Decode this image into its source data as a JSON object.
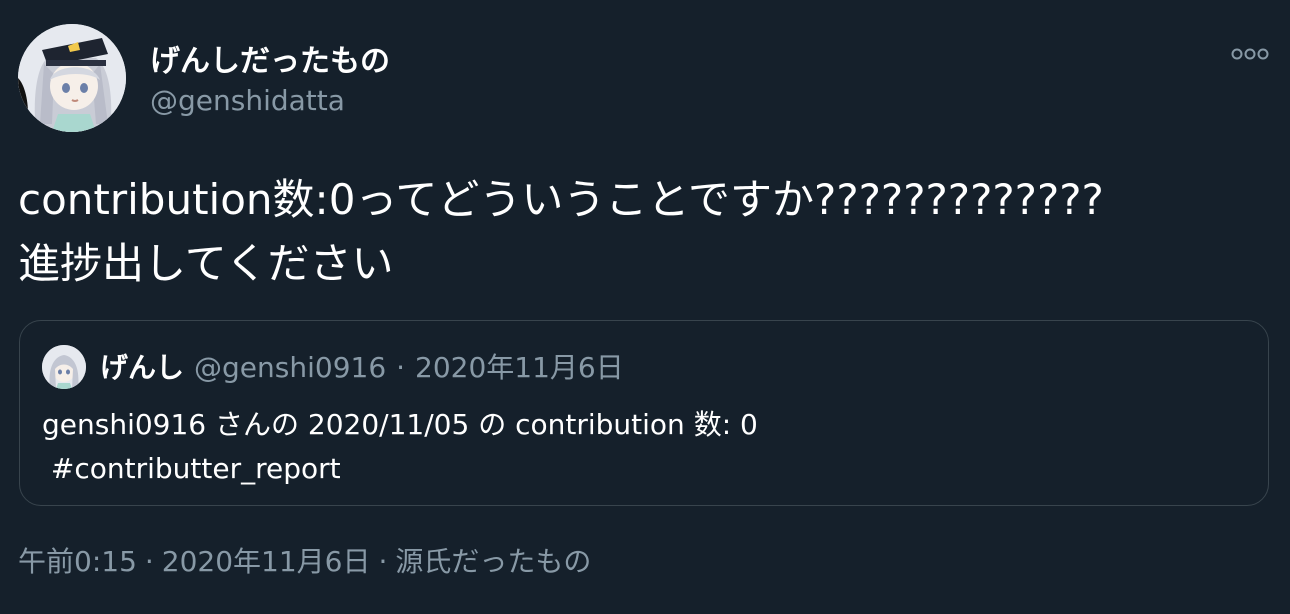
{
  "author": {
    "display_name": "げんしだったもの",
    "handle": "@genshidatta"
  },
  "tweet": {
    "text": "contribution数:0ってどういうことですか?????????????\n進捗出してください"
  },
  "icons": {
    "more": "more-options-icon",
    "avatar": "anime-avatar"
  },
  "quoted_tweet": {
    "display_name": "げんし",
    "handle": "@genshi0916",
    "separator": "·",
    "date": "2020年11月6日",
    "text": "genshi0916 さんの 2020/11/05 の contribution 数: 0\n #contributter_report"
  },
  "footer": {
    "time": "午前0:15",
    "date": "2020年11月6日",
    "source": "源氏だったもの",
    "separator": "·"
  },
  "colors": {
    "background": "#15202b",
    "border": "#38444d",
    "secondary_text": "#8899a6",
    "primary_text": "#ffffff"
  }
}
